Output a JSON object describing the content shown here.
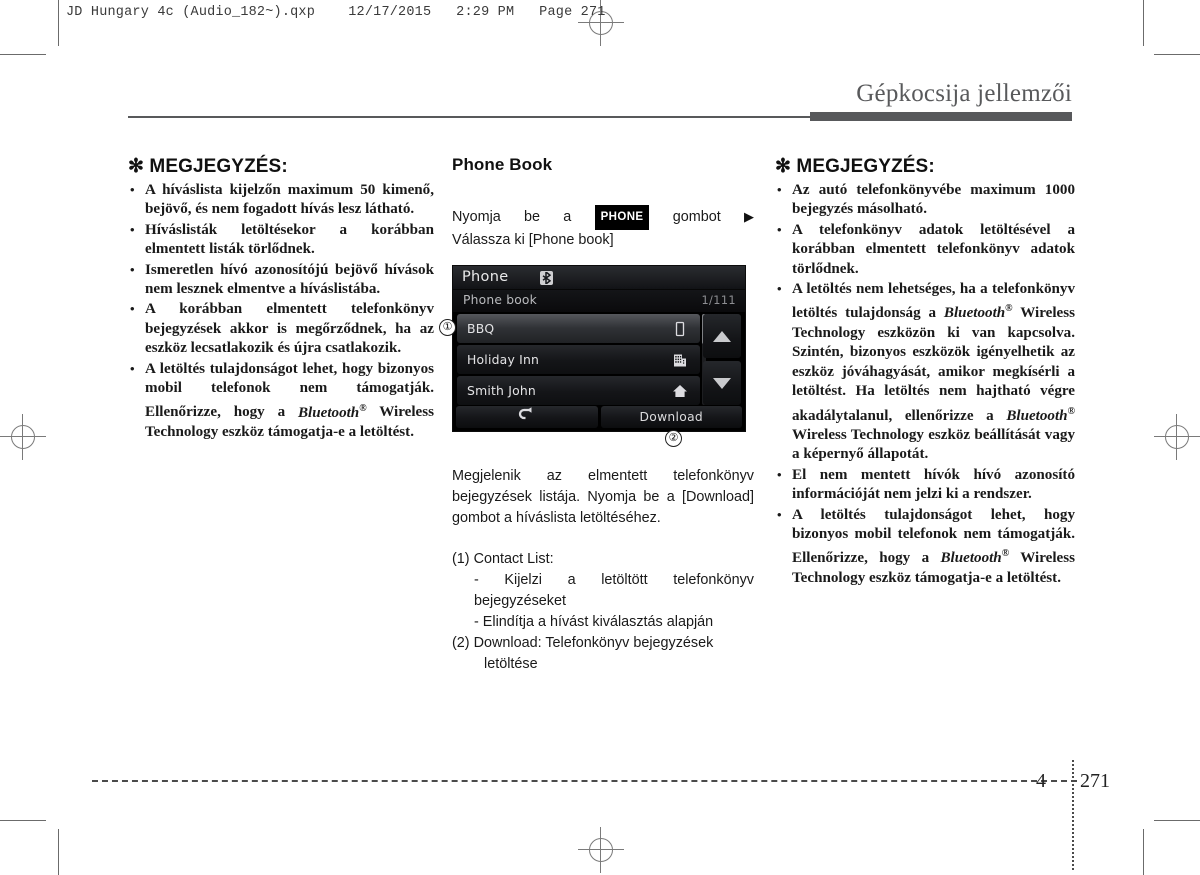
{
  "slug": "JD Hungary 4c (Audio_182~).qxp    12/17/2015   2:29 PM   Page 271",
  "chapter": {
    "title": "Gépkocsija jellemzői"
  },
  "footer": {
    "chapter_number": "4",
    "page_number": "271"
  },
  "left_column": {
    "note_heading": "✻ MEGJEGYZÉS:",
    "items": [
      "A híváslista kijelzőn maximum 50 kimenő, bejövő, és nem fogadott hívás lesz látható.",
      "Híváslisták letöltésekor a korábban elmentett listák törlődnek.",
      "Ismeretlen hívó azonosítójú bejövő hívások nem lesznek elmentve a híváslistába.",
      "A korábban elmentett telefonkönyv bejegyzések akkor is megőrződnek, ha az eszköz lecsatlakozik és újra csatlakozik."
    ],
    "last_item": {
      "part1": "A letöltés tulajdonságot lehet, hogy bizonyos mobil telefonok nem támogatják. Ellenőrizze, hogy a ",
      "brand": "Bluetooth",
      "brand_sup": "®",
      "part2": " Wireless Technology eszköz támogatja-e a letöltést."
    }
  },
  "middle_column": {
    "heading": "Phone Book",
    "instruction_line1_a": "Nyomja be a",
    "instruction_keycap": "PHONE",
    "instruction_line1_b": "gombot",
    "instruction_arrow": "▶",
    "instruction_line2": "Válassza ki [Phone book]",
    "device": {
      "title": "Phone",
      "bluetooth_icon": "bluetooth-icon",
      "subtitle": "Phone book",
      "page_indicator": "1/111",
      "contacts": [
        {
          "name": "BBQ",
          "icon": "mobile-phone-icon",
          "selected": true
        },
        {
          "name": "Holiday Inn",
          "icon": "office-building-icon",
          "selected": false
        },
        {
          "name": "Smith John",
          "icon": "home-icon",
          "selected": false
        }
      ],
      "scroll_up": "scroll-up-arrow-icon",
      "scroll_down": "scroll-down-arrow-icon",
      "back_button": "back-arrow-icon",
      "download_button": "Download",
      "callout_1": "①",
      "callout_2": "②"
    },
    "paragraph": "Megjelenik az elmentett telefonkönyv bejegyzések listája. Nyomja be a [Download] gombot a híváslista letöltéséhez.",
    "legend": {
      "item1_label": "(1) Contact List:",
      "item1_sub1": "- Kijelzi a letöltött telefonkönyv bejegyzéseket",
      "item1_sub2": "- Elindítja a hívást kiválasztás alapján",
      "item2_label": "(2) Download: Telefonkönyv bejegyzések",
      "item2_cont": "letöltése"
    }
  },
  "right_column": {
    "note_heading": "✻ MEGJEGYZÉS:",
    "item1": "Az autó telefonkönyvébe maximum 1000 bejegyzés másolható.",
    "item2": "A telefonkönyv adatok letöltésével a korábban elmentett telefonkönyv adatok törlődnek.",
    "item3": {
      "part1": "A letöltés nem lehetséges, ha a telefonkönyv letöltés tulajdonság a ",
      "brand1": "Bluetooth",
      "brand1_sup": "®",
      "part2": " Wireless Technology eszközön ki van kapcsolva. Szintén, bizonyos eszközök igényelhetik az eszköz jóváhagyását, amikor megkísérli a letöltést. Ha letöltés nem hajtható végre akadálytalanul, ellenőrizze a ",
      "brand2": "Bluetooth",
      "brand2_sup": "®",
      "part3": " Wireless Technology eszköz beállítását vagy a képernyő állapotát."
    },
    "item4": "El nem mentett hívók hívó azonosító információját nem jelzi ki a rendszer.",
    "item5": {
      "part1": "A letöltés tulajdonságot lehet, hogy bizonyos mobil telefonok nem támogatják. Ellenőrizze, hogy a ",
      "brand": "Bluetooth",
      "brand_sup": "®",
      "part2": " Wireless Technology eszköz támogatja-e a letöltést."
    }
  }
}
